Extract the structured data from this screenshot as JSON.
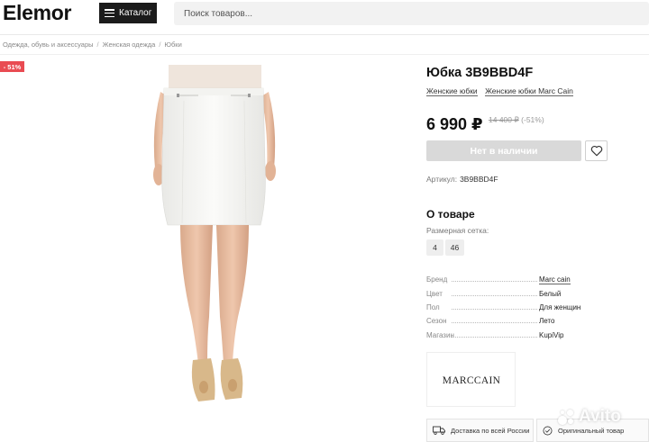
{
  "header": {
    "logo": "Elemor",
    "catalog_label": "Каталог",
    "search_placeholder": "Поиск товаров..."
  },
  "breadcrumb": [
    "Одежда, обувь и аксессуары",
    "Женская одежда",
    "Юбки"
  ],
  "discount_badge": "- 51%",
  "product": {
    "title": "Юбка 3B9BBD4F",
    "categories": [
      "Женские юбки",
      "Женские юбки Marc Cain"
    ],
    "price": "6 990 ₽",
    "old_price": "14 400 ₽",
    "discount": "(-51%)",
    "stock_button": "Нет в наличии",
    "sku_label": "Артикул:",
    "sku_value": "3B9BBD4F"
  },
  "about": {
    "heading": "О товаре",
    "size_label": "Размерная сетка:",
    "sizes": [
      "4",
      "46"
    ]
  },
  "specs": [
    {
      "key": "Бренд",
      "value": "Marc cain"
    },
    {
      "key": "Цвет",
      "value": "Белый"
    },
    {
      "key": "Пол",
      "value": "Для женщин"
    },
    {
      "key": "Сезон",
      "value": "Лето"
    },
    {
      "key": "Магазин",
      "value": "KupiVip"
    }
  ],
  "brand_logo": "MARCCAIN",
  "features": [
    {
      "icon": "truck-icon",
      "label": "Доставка по всей России"
    },
    {
      "icon": "check-icon",
      "label": "Оригинальный товар"
    }
  ],
  "watermark": "Avito",
  "colors": {
    "badge": "#e94b52",
    "catalog_button": "#1b1b1b",
    "stock_button_disabled": "#d9d9d9"
  }
}
